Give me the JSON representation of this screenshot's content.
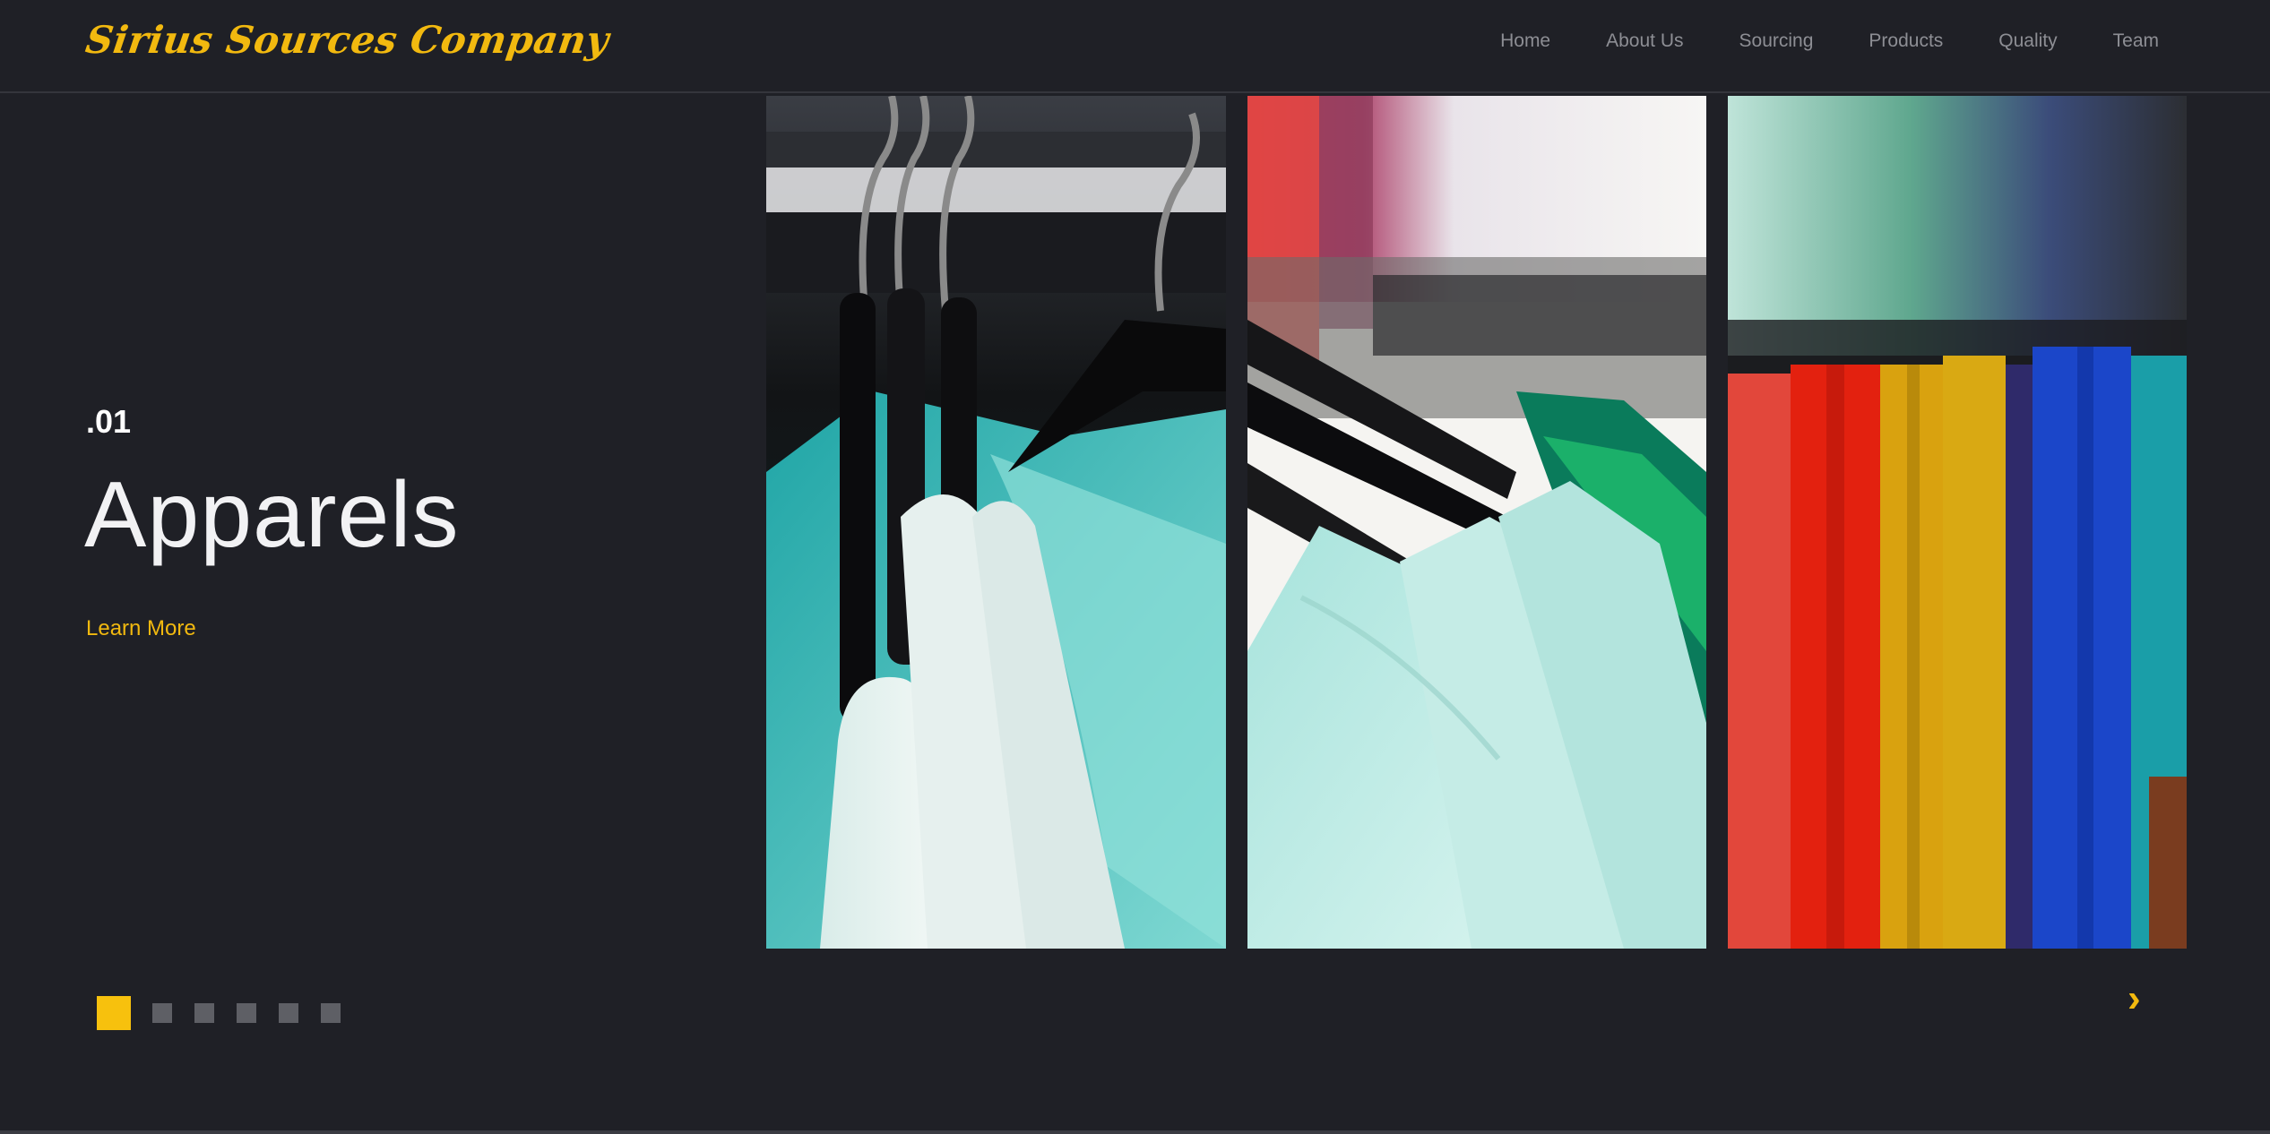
{
  "header": {
    "logo_text": "Sirius Sources Company",
    "nav": [
      {
        "label": "Home"
      },
      {
        "label": "About Us"
      },
      {
        "label": "Sourcing"
      },
      {
        "label": "Products"
      },
      {
        "label": "Quality"
      },
      {
        "label": "Team"
      }
    ]
  },
  "slide": {
    "number": ".01",
    "title": "Apparels",
    "cta_label": "Learn More",
    "images": [
      {
        "icon": "clothes-on-hangers-teal-photo"
      },
      {
        "icon": "mint-shirts-on-rack-photo"
      },
      {
        "icon": "colorful-garments-rack-photo"
      }
    ]
  },
  "carousel": {
    "total_slides": 6,
    "active_index": 0,
    "next_label": "›"
  },
  "colors": {
    "background": "#1f2026",
    "accent": "#f2b90f",
    "nav_text": "#8d8e94",
    "inactive_dot": "#5e5f65"
  }
}
